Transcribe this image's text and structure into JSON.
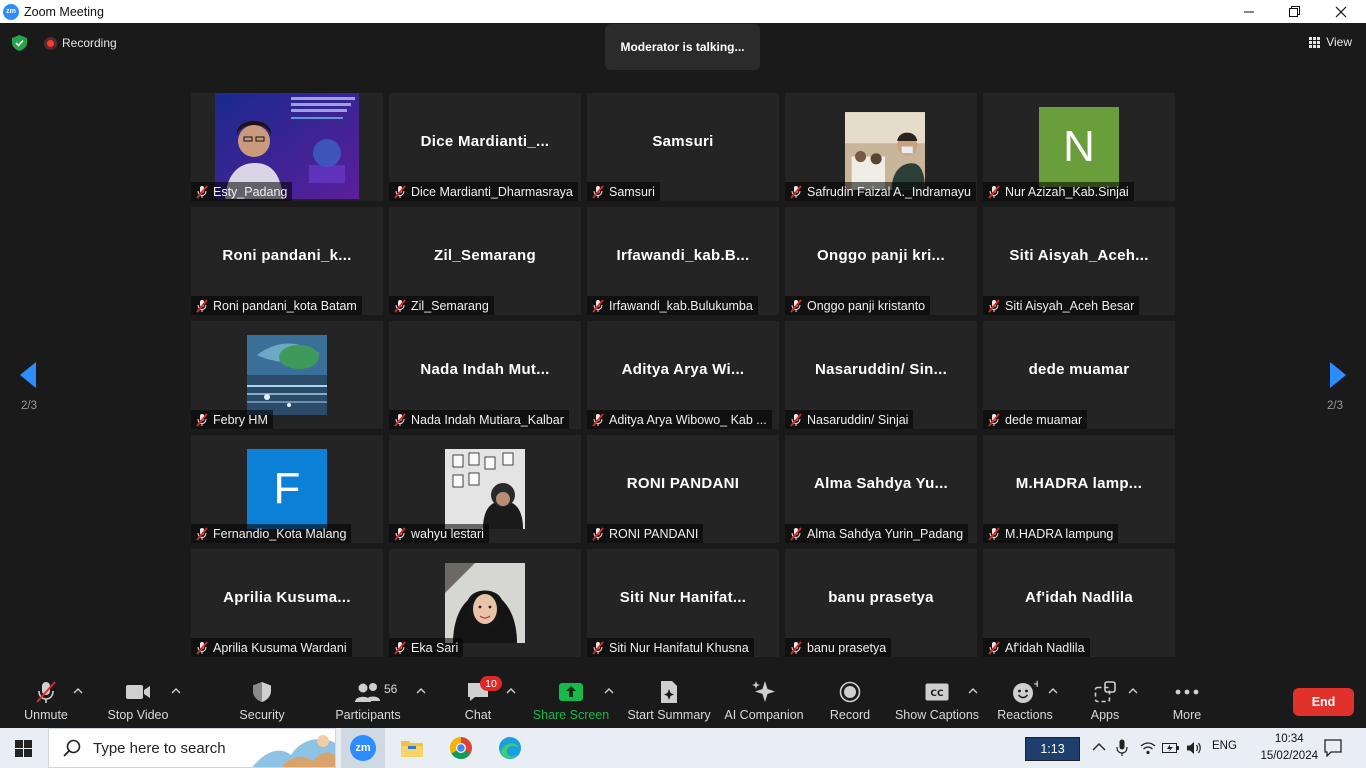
{
  "window": {
    "title": "Zoom Meeting",
    "app_logo": "zm"
  },
  "topbar": {
    "recording_label": "Recording",
    "view_label": "View",
    "toast": "Moderator is talking..."
  },
  "gallery": {
    "page_indicator": "2/3",
    "tiles": [
      {
        "big": "",
        "label": "Esty_Padang",
        "kind": "video-webinar"
      },
      {
        "big": "Dice  Mardianti_...",
        "label": "Dice Mardianti_Dharmasraya",
        "kind": "name"
      },
      {
        "big": "Samsuri",
        "label": "Samsuri",
        "kind": "name"
      },
      {
        "big": "",
        "label": "Safrudin Faizal A._Indramayu",
        "kind": "photo-room"
      },
      {
        "big": "N",
        "label": "Nur Azizah_Kab.Sinjai",
        "kind": "letter",
        "color": "#6a9e3a"
      },
      {
        "big": "Roni  pandani_k...",
        "label": "Roni pandani_kota Batam",
        "kind": "name"
      },
      {
        "big": "Zil_Semarang",
        "label": "Zil_Semarang",
        "kind": "name"
      },
      {
        "big": "Irfawandi_kab.B...",
        "label": "Irfawandi_kab.Bulukumba",
        "kind": "name"
      },
      {
        "big": "Onggo  panji  kri...",
        "label": "Onggo panji kristanto",
        "kind": "name"
      },
      {
        "big": "Siti  Aisyah_Aceh...",
        "label": "Siti Aisyah_Aceh Besar",
        "kind": "name"
      },
      {
        "big": "",
        "label": "Febry HM",
        "kind": "photo-tech"
      },
      {
        "big": "Nada  Indah  Mut...",
        "label": "Nada Indah Mutiara_Kalbar",
        "kind": "name"
      },
      {
        "big": "Aditya  Arya  Wi...",
        "label": "Aditya Arya Wibowo_ Kab ...",
        "kind": "name"
      },
      {
        "big": "Nasaruddin/  Sin...",
        "label": "Nasaruddin/ Sinjai",
        "kind": "name"
      },
      {
        "big": "dede muamar",
        "label": "dede muamar",
        "kind": "name"
      },
      {
        "big": "F",
        "label": "Fernandio_Kota Malang",
        "kind": "letter",
        "color": "#0b80d6"
      },
      {
        "big": "",
        "label": "wahyu lestari",
        "kind": "photo-wall"
      },
      {
        "big": "RONI PANDANI",
        "label": "RONI PANDANI",
        "kind": "name"
      },
      {
        "big": "Alma  Sahdya  Yu...",
        "label": "Alma Sahdya Yurin_Padang",
        "kind": "name"
      },
      {
        "big": "M.HADRA  lamp...",
        "label": "M.HADRA lampung",
        "kind": "name"
      },
      {
        "big": "Aprilia  Kusuma...",
        "label": "Aprilia Kusuma Wardani",
        "kind": "name"
      },
      {
        "big": "",
        "label": "Eka Sari",
        "kind": "photo-hijab"
      },
      {
        "big": "Siti  Nur  Hanifat...",
        "label": "Siti Nur Hanifatul Khusna",
        "kind": "name"
      },
      {
        "big": "banu prasetya",
        "label": "banu prasetya",
        "kind": "name"
      },
      {
        "big": "Af'idah Nadlila",
        "label": "Af'idah Nadlila",
        "kind": "name"
      }
    ]
  },
  "toolbar": {
    "unmute": "Unmute",
    "stop_video": "Stop Video",
    "security": "Security",
    "participants": "Participants",
    "participants_count": "56",
    "chat": "Chat",
    "chat_badge": "10",
    "share_screen": "Share Screen",
    "start_summary": "Start Summary",
    "ai_companion": "AI Companion",
    "record": "Record",
    "show_captions": "Show Captions",
    "reactions": "Reactions",
    "apps": "Apps",
    "more": "More",
    "end": "End"
  },
  "taskbar": {
    "search_placeholder": "Type here to search",
    "timer": "1:13",
    "language": "ENG",
    "time": "10:34",
    "date": "15/02/2024"
  },
  "colors": {
    "share_green": "#18b84a",
    "end_red": "#e0312b",
    "badge_red": "#e02828",
    "zoom_blue": "#2d8cff"
  }
}
